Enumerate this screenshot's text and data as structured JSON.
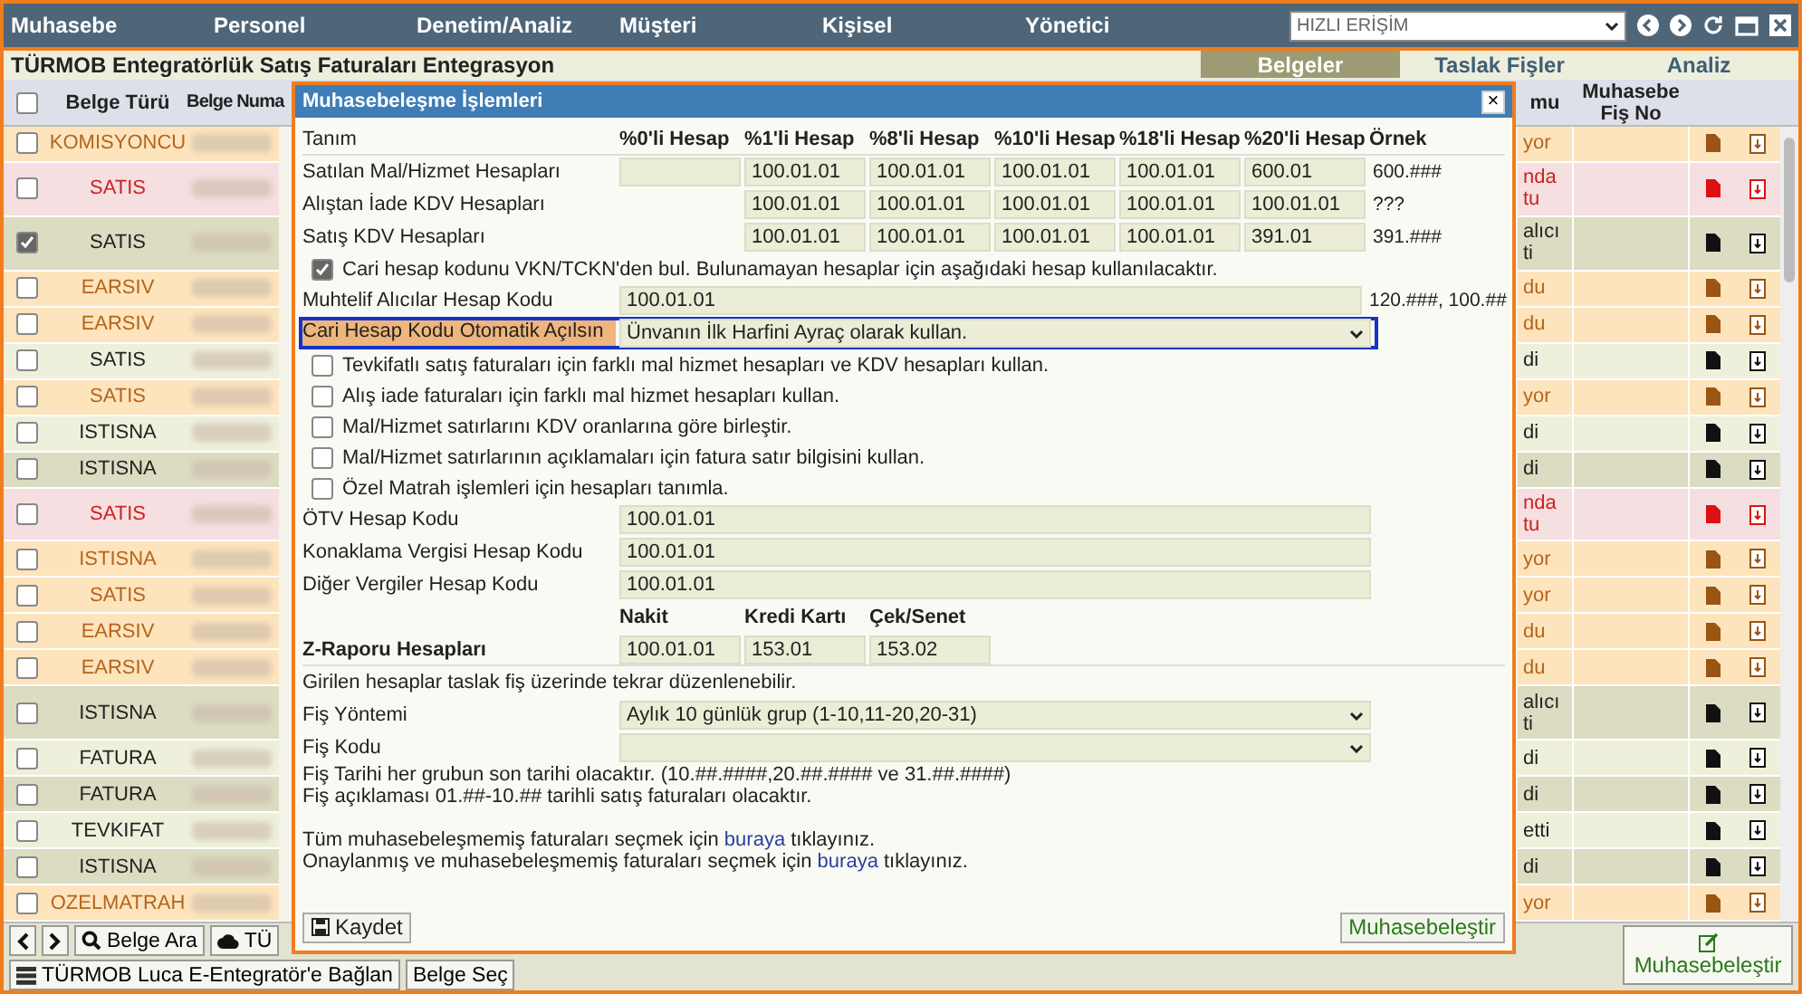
{
  "menu": {
    "items": [
      "Muhasebe",
      "Personel",
      "Denetim/Analiz",
      "Müşteri",
      "Kişisel",
      "Yönetici"
    ],
    "quick_access": {
      "value": "HIZLI ERİŞİM"
    }
  },
  "page": {
    "title": "TÜRMOB Entegratörlük Satış Faturaları Entegrasyon",
    "tabs": [
      {
        "label": "Belgeler",
        "selected": true
      },
      {
        "label": "Taslak Fişler",
        "selected": false
      },
      {
        "label": "Analiz",
        "selected": false
      }
    ]
  },
  "table": {
    "select_all": {
      "checked": false
    },
    "columns": [
      "Belge Türü",
      "Belge Numa",
      "mu",
      "Muhasebe Fiş No"
    ],
    "rows": [
      {
        "type": "KOMISYONCU",
        "kind": "orange",
        "checked": false,
        "status": "yor"
      },
      {
        "type": "SATIS",
        "kind": "red",
        "checked": false,
        "status": "nda\ntu"
      },
      {
        "type": "SATIS",
        "kind": "olive",
        "checked": true,
        "status": "alıcı\nti"
      },
      {
        "type": "EARSIV",
        "kind": "orange",
        "checked": false,
        "status": "du"
      },
      {
        "type": "EARSIV",
        "kind": "orange",
        "checked": false,
        "status": "du"
      },
      {
        "type": "SATIS",
        "kind": "green",
        "checked": false,
        "status": "di"
      },
      {
        "type": "SATIS",
        "kind": "orange",
        "checked": false,
        "status": "yor"
      },
      {
        "type": "ISTISNA",
        "kind": "green",
        "checked": false,
        "status": "di"
      },
      {
        "type": "ISTISNA",
        "kind": "olive",
        "checked": false,
        "status": "di"
      },
      {
        "type": "SATIS",
        "kind": "red",
        "checked": false,
        "status": "nda\ntu"
      },
      {
        "type": "ISTISNA",
        "kind": "orange",
        "checked": false,
        "status": "yor"
      },
      {
        "type": "SATIS",
        "kind": "orange",
        "checked": false,
        "status": "yor"
      },
      {
        "type": "EARSIV",
        "kind": "orange",
        "checked": false,
        "status": "du"
      },
      {
        "type": "EARSIV",
        "kind": "orange",
        "checked": false,
        "status": "du"
      },
      {
        "type": "ISTISNA",
        "kind": "olive",
        "checked": false,
        "status": "alıcı\nti"
      },
      {
        "type": "FATURA",
        "kind": "green",
        "checked": false,
        "status": "di"
      },
      {
        "type": "FATURA",
        "kind": "olive",
        "checked": false,
        "status": "di"
      },
      {
        "type": "TEVKIFAT",
        "kind": "green",
        "checked": false,
        "status": "etti"
      },
      {
        "type": "ISTISNA",
        "kind": "olive",
        "checked": false,
        "status": "di"
      },
      {
        "type": "OZELMATRAH",
        "kind": "orange",
        "checked": false,
        "status": "yor"
      }
    ]
  },
  "toolbar": {
    "search_button": "Belge Ara",
    "upload_button": "TÜ",
    "connect_button": "TÜRMOB Luca E-Entegratör'e Bağlan",
    "select_button": "Belge Seç",
    "post_button": "Muhasebeleştir"
  },
  "dialog": {
    "title": "Muhasebeleşme İşlemleri",
    "close": "×",
    "columns": [
      "Tanım",
      "%0'li Hesap",
      "%1'li Hesap",
      "%8'li Hesap",
      "%10'li Hesap",
      "%18'li Hesap",
      "%20'li Hesap",
      "Örnek"
    ],
    "account_rows": [
      {
        "label": "Satılan Mal/Hizmet Hesapları",
        "cells": [
          {
            "kind": "field"
          },
          {
            "kind": "field",
            "value": "100.01.01"
          },
          {
            "kind": "field",
            "value": "100.01.01"
          },
          {
            "kind": "field",
            "value": "100.01.01"
          },
          {
            "kind": "field",
            "value": "100.01.01"
          },
          {
            "kind": "field",
            "value": "600.01"
          }
        ],
        "example": "600.###"
      },
      {
        "label": "Alıştan İade KDV Hesapları",
        "cells": [
          {
            "kind": "none"
          },
          {
            "kind": "field",
            "value": "100.01.01"
          },
          {
            "kind": "field",
            "value": "100.01.01"
          },
          {
            "kind": "field",
            "value": "100.01.01"
          },
          {
            "kind": "field",
            "value": "100.01.01"
          },
          {
            "kind": "field",
            "value": "100.01.01"
          }
        ],
        "example": "???"
      },
      {
        "label": "Satış KDV Hesapları",
        "cells": [
          {
            "kind": "none"
          },
          {
            "kind": "field",
            "value": "100.01.01"
          },
          {
            "kind": "field",
            "value": "100.01.01"
          },
          {
            "kind": "field",
            "value": "100.01.01"
          },
          {
            "kind": "field",
            "value": "100.01.01"
          },
          {
            "kind": "field",
            "value": "391.01"
          }
        ],
        "example": "391.###"
      }
    ],
    "vkn_option": {
      "label": "Cari hesap kodunu VKN/TCKN'den bul. Bulunamayan hesaplar için aşağıdaki hesap kullanılacaktır.",
      "checked": true
    },
    "misc_buyers": {
      "label": "Muhtelif Alıcılar Hesap Kodu",
      "value": "100.01.01",
      "example": "120.###, 100.##"
    },
    "auto_open": {
      "label": "Cari Hesap Kodu Otomatik Açılsın",
      "value": "Ünvanın İlk Harfini Ayraç olarak kullan.",
      "focused": true
    },
    "options": [
      {
        "label": "Tevkifatlı satış faturaları için farklı mal hizmet hesapları ve KDV hesapları kullan.",
        "checked": false
      },
      {
        "label": "Alış iade faturaları için farklı mal hizmet hesapları kullan.",
        "checked": false
      },
      {
        "label": "Mal/Hizmet satırlarını KDV oranlarına göre birleştir.",
        "checked": false
      },
      {
        "label": "Mal/Hizmet satırlarının açıklamaları için fatura satır bilgisini kullan.",
        "checked": false
      },
      {
        "label": "Özel Matrah işlemleri için hesapları tanımla.",
        "checked": false
      }
    ],
    "tax_fields": [
      {
        "label": "ÖTV Hesap Kodu",
        "value": "100.01.01"
      },
      {
        "label": "Konaklama Vergisi Hesap Kodu",
        "value": "100.01.01"
      },
      {
        "label": "Diğer Vergiler Hesap Kodu",
        "value": "100.01.01"
      }
    ],
    "z_report": {
      "label": "Z-Raporu Hesapları",
      "columns": [
        "Nakit",
        "Kredi Kartı",
        "Çek/Senet"
      ],
      "values": [
        "100.01.01",
        "153.01",
        "153.02"
      ]
    },
    "edit_note": "Girilen hesaplar taslak fiş üzerinde tekrar düzenlenebilir.",
    "method": {
      "label": "Fiş Yöntemi",
      "value": "Aylık 10 günlük grup (1-10,11-20,20-31)"
    },
    "code": {
      "label": "Fiş Kodu"
    },
    "notes": [
      "Fiş Tarihi her grubun son tarihi olacaktır. (10.##.####,20.##.#### ve 31.##.####)",
      "Fiş açıklaması 01.##-10.## tarihli satış faturaları olacaktır."
    ],
    "links": [
      {
        "before": "Tüm muhasebeleşmemiş faturaları seçmek için",
        "link": "buraya",
        "after": "tıklayınız."
      },
      {
        "before": "Onaylanmış ve muhasebeleşmemiş faturaları seçmek için",
        "link": "buraya",
        "after": "tıklayınız."
      }
    ],
    "save_button": "Kaydet",
    "post_button": "Muhasebeleştir"
  }
}
